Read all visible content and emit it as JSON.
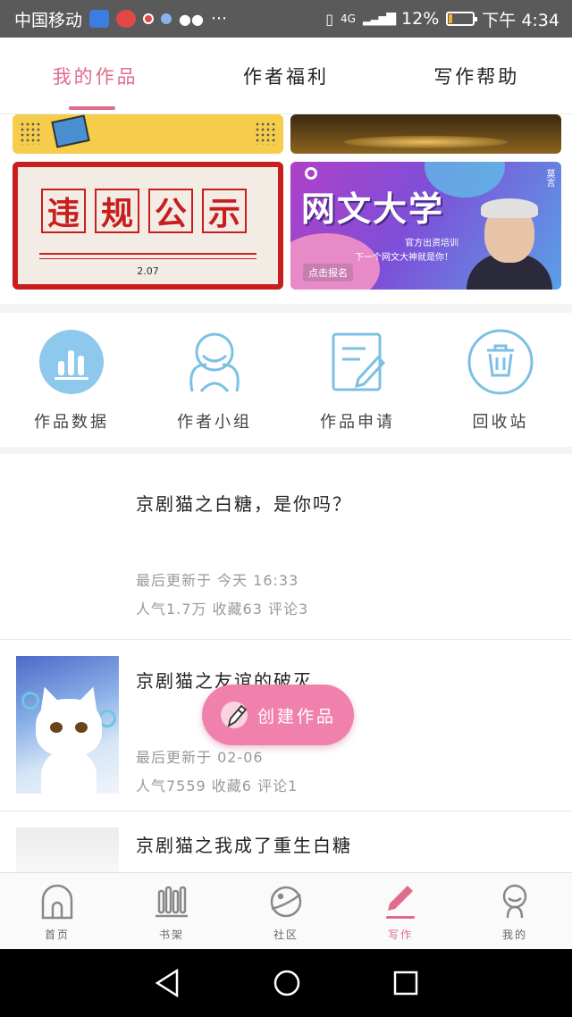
{
  "status_bar": {
    "carrier": "中国移动",
    "network": "4G",
    "battery": "12%",
    "battery_level": 0.12,
    "time": "下午 4:34"
  },
  "tabs": [
    {
      "label": "我的作品",
      "active": true
    },
    {
      "label": "作者福利",
      "active": false
    },
    {
      "label": "写作帮助",
      "active": false
    }
  ],
  "banners": {
    "violation": {
      "chars": [
        "违",
        "规",
        "公",
        "示"
      ],
      "date": "2.07"
    },
    "university": {
      "title": "网文大学",
      "tag": "莫言",
      "line1": "官方出资培训",
      "line2": "下一个网文大神就是你！",
      "button": "点击报名"
    }
  },
  "functions": [
    {
      "label": "作品数据",
      "icon": "bar-chart-icon"
    },
    {
      "label": "作者小组",
      "icon": "group-icon"
    },
    {
      "label": "作品申请",
      "icon": "edit-document-icon"
    },
    {
      "label": "回收站",
      "icon": "trash-icon"
    }
  ],
  "works": [
    {
      "title": "京剧猫之白糖，是你吗？",
      "updated": "最后更新于 今天 16:33",
      "stats": "人气1.7万 收藏63 评论3"
    },
    {
      "title": "京剧猫之友谊的破灭",
      "updated": "最后更新于 02-06",
      "stats": "人气7559 收藏6 评论1"
    },
    {
      "title": "京剧猫之我成了重生白糖",
      "updated": "",
      "stats": ""
    }
  ],
  "create_button": {
    "label": "创建作品"
  },
  "bottom_nav": [
    {
      "label": "首页",
      "icon": "home-icon",
      "active": false
    },
    {
      "label": "书架",
      "icon": "bookshelf-icon",
      "active": false
    },
    {
      "label": "社区",
      "icon": "planet-icon",
      "active": false
    },
    {
      "label": "写作",
      "icon": "pen-icon",
      "active": true
    },
    {
      "label": "我的",
      "icon": "profile-icon",
      "active": false
    }
  ],
  "colors": {
    "accent": "#e06b8b",
    "create_button": "#f081ac",
    "icon_blue": "#6ab8e0",
    "violation_red": "#c81e1e"
  }
}
